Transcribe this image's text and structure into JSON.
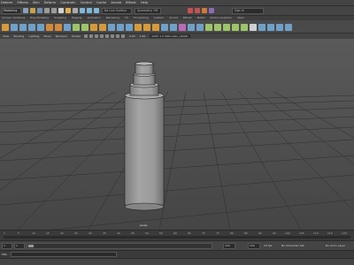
{
  "menubar": {
    "items": [
      "Deform",
      "Effects",
      "Skin",
      "Deform",
      "Constrain",
      "Control",
      "Cache",
      "Arnold",
      "Bifrost",
      "Help"
    ]
  },
  "statusline": {
    "mode": "Modeling",
    "objects_field": "No Live Surface",
    "symmetry_field": "Symmetry: Off",
    "sign_in": "Sign In"
  },
  "shelf": {
    "tabs": [
      "Curves / Surfaces",
      "Poly Modeling",
      "Sculpting",
      "Rigging",
      "Animation",
      "Rendering",
      "FX",
      "FX Caching",
      "Custom",
      "Arnold",
      "Bifrost",
      "MASH",
      "Motion Graphics",
      "XGen"
    ]
  },
  "panel": {
    "menus": [
      "View",
      "Shading",
      "Lighting",
      "Show",
      "Renderer",
      "Panels"
    ],
    "gamma": "0.00",
    "exposure": "1.00",
    "colorspace": "ACES 1.0 SDR-video (sRGB)"
  },
  "viewport": {
    "camera_label": "persp"
  },
  "timeslider": {
    "ticks": [
      "1",
      "5",
      "10",
      "15",
      "20",
      "25",
      "30",
      "35",
      "40",
      "45",
      "50",
      "55",
      "60",
      "65",
      "70",
      "75",
      "80",
      "85",
      "90",
      "95",
      "100",
      "105",
      "110",
      "115",
      "120"
    ]
  },
  "rangebar": {
    "start": "1",
    "start_inner": "1",
    "end_inner": "120",
    "end": "200",
    "fps": "24 fps",
    "char_set": "No Character Set",
    "anim_layer": "No Anim Layer"
  },
  "cmdline": {
    "label": "MEL"
  },
  "colors": {
    "accent": "#2f8ad6",
    "viewport_top": "#5a5a5a",
    "viewport_bottom": "#454545",
    "grid": "#2e2e2e",
    "bottle": "#9a9a9a"
  }
}
